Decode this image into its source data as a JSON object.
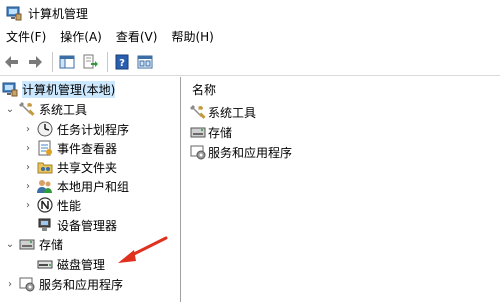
{
  "window": {
    "title": "计算机管理"
  },
  "menu": [
    {
      "label": "文件(F)"
    },
    {
      "label": "操作(A)"
    },
    {
      "label": "查看(V)"
    },
    {
      "label": "帮助(H)"
    }
  ],
  "toolbar": {
    "icons": [
      "back-arrow-icon",
      "forward-arrow-icon",
      "show-hide-tree-icon",
      "export-list-icon",
      "help-icon",
      "properties-icon"
    ]
  },
  "tree": {
    "root": {
      "label": "计算机管理(本地)",
      "icon": "computer-management-icon",
      "selected": true
    },
    "system_tools": {
      "label": "系统工具",
      "icon": "tools-icon",
      "children": [
        {
          "label": "任务计划程序",
          "icon": "clock-icon"
        },
        {
          "label": "事件查看器",
          "icon": "event-viewer-icon"
        },
        {
          "label": "共享文件夹",
          "icon": "shared-folder-icon"
        },
        {
          "label": "本地用户和组",
          "icon": "users-icon"
        },
        {
          "label": "性能",
          "icon": "performance-icon"
        },
        {
          "label": "设备管理器",
          "icon": "device-manager-icon"
        }
      ]
    },
    "storage": {
      "label": "存储",
      "icon": "storage-icon",
      "children": [
        {
          "label": "磁盘管理",
          "icon": "disk-icon"
        }
      ]
    },
    "services": {
      "label": "服务和应用程序",
      "icon": "services-icon"
    }
  },
  "list": {
    "column_header": "名称",
    "items": [
      {
        "label": "系统工具",
        "icon": "tools-icon"
      },
      {
        "label": "存储",
        "icon": "storage-icon"
      },
      {
        "label": "服务和应用程序",
        "icon": "services-icon"
      }
    ]
  },
  "colors": {
    "selection": "#cce8ff",
    "arrow": "#e0301e"
  }
}
